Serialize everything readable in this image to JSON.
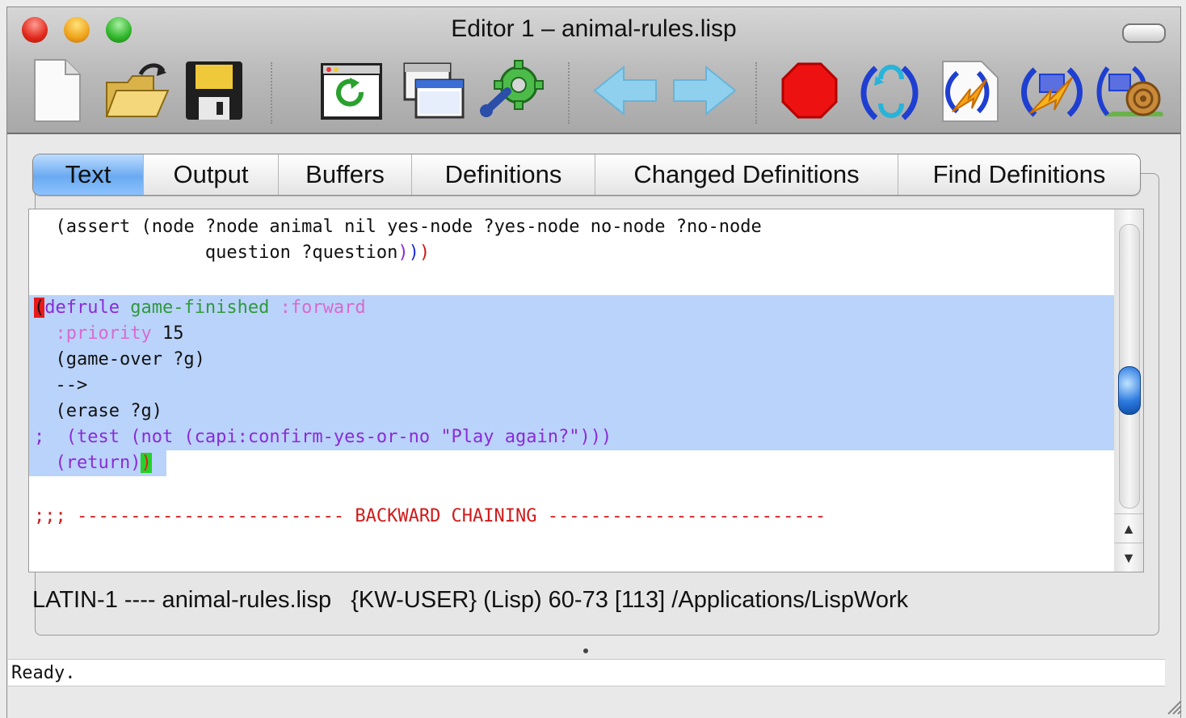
{
  "window": {
    "title": "Editor 1 – animal-rules.lisp"
  },
  "toolbar": {
    "buttons": [
      {
        "name": "new-file",
        "icon": "new-document-icon"
      },
      {
        "name": "open-file",
        "icon": "open-folder-icon"
      },
      {
        "name": "save-file",
        "icon": "save-floppy-icon"
      },
      {
        "name": "compile-buffer",
        "icon": "refresh-window-icon"
      },
      {
        "name": "new-window",
        "icon": "windows-icon"
      },
      {
        "name": "tools",
        "icon": "gear-wrench-icon"
      },
      {
        "name": "back",
        "icon": "arrow-left-icon"
      },
      {
        "name": "forward",
        "icon": "arrow-right-icon"
      },
      {
        "name": "stop",
        "icon": "stop-octagon-icon"
      },
      {
        "name": "evaluate",
        "icon": "parentheses-cycle-icon"
      },
      {
        "name": "break",
        "icon": "lightning-doc-icon"
      },
      {
        "name": "break-window",
        "icon": "lightning-window-icon"
      },
      {
        "name": "step",
        "icon": "snail-icon"
      }
    ]
  },
  "tabs": [
    {
      "label": "Text",
      "active": true
    },
    {
      "label": "Output",
      "active": false
    },
    {
      "label": "Buffers",
      "active": false
    },
    {
      "label": "Definitions",
      "active": false
    },
    {
      "label": "Changed Definitions",
      "active": false
    },
    {
      "label": "Find Definitions",
      "active": false
    }
  ],
  "editor": {
    "lines": [
      {
        "segments": [
          {
            "t": "  ",
            "c": "black"
          },
          {
            "t": "(assert (",
            "c": "black"
          },
          {
            "t": "node ?node animal nil yes-node ?yes-node no-node ?no-node",
            "c": "black"
          }
        ]
      },
      {
        "segments": [
          {
            "t": "                question ?question",
            "c": "black"
          },
          {
            "t": ")",
            "c": "purple"
          },
          {
            "t": ")",
            "c": "blue"
          },
          {
            "t": ")",
            "c": "red"
          }
        ]
      },
      {
        "segments": [
          {
            "t": "",
            "c": "black"
          }
        ]
      },
      {
        "segments": [
          {
            "t": "(",
            "c": "paren-mark"
          },
          {
            "t": "defrule ",
            "c": "purple"
          },
          {
            "t": "game-finished ",
            "c": "green"
          },
          {
            "t": ":forward",
            "c": "pink"
          }
        ],
        "highlight": true
      },
      {
        "segments": [
          {
            "t": "  ",
            "c": "black"
          },
          {
            "t": ":priority",
            "c": "pink"
          },
          {
            "t": " 15",
            "c": "black"
          }
        ],
        "highlight": true
      },
      {
        "segments": [
          {
            "t": "  (game-over ?g)",
            "c": "black"
          }
        ],
        "highlight": true
      },
      {
        "segments": [
          {
            "t": "  -->",
            "c": "black"
          }
        ],
        "highlight": true
      },
      {
        "segments": [
          {
            "t": "  (erase ?g)",
            "c": "black"
          }
        ],
        "highlight": true
      },
      {
        "segments": [
          {
            "t": ";  (test (not (capi:confirm-yes-or-no \"Play again?\")))",
            "c": "purple"
          }
        ],
        "highlight": true
      },
      {
        "segments": [
          {
            "t": "  ",
            "c": "black"
          },
          {
            "t": "(return)",
            "c": "purple"
          },
          {
            "t": ")",
            "c": "paren-match"
          }
        ],
        "highlight": "partial"
      },
      {
        "segments": [
          {
            "t": "",
            "c": "black"
          }
        ]
      },
      {
        "segments": [
          {
            "t": ";;; ------------------------- BACKWARD CHAINING --------------------------",
            "c": "darkred"
          }
        ]
      }
    ]
  },
  "modeline": {
    "text": "LATIN-1 ---- animal-rules.lisp   {KW-USER} (Lisp) 60-73 [113] /Applications/LispWork"
  },
  "status": {
    "text": "Ready."
  },
  "colors": {
    "active_tab": "#6aaaf0",
    "selection": "#bad3fb",
    "keyword": "#8a2bd8",
    "rule_name": "#2e9a3c",
    "keyword_arg": "#d96ad0",
    "comment": "#c0282c"
  }
}
